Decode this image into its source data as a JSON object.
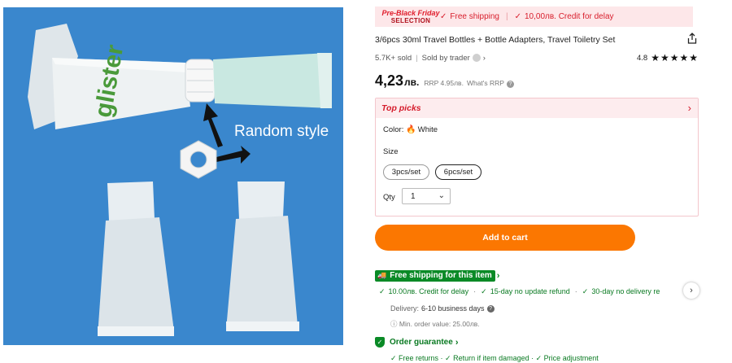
{
  "image": {
    "overlay_text": "Random style",
    "tube_brand_text": "glister"
  },
  "promo": {
    "logo_line1": "Pre-Black Friday",
    "logo_line2": "SELECTION",
    "free_shipping": "Free shipping",
    "credit": "10,00лв. Credit for delay",
    "accent_color": "#d81e2c"
  },
  "product": {
    "title": "3/6pcs 30ml Travel Bottles + Bottle Adapters, Travel Toiletry Set",
    "sold": "5.7K+ sold",
    "sold_by_label": "Sold by trader",
    "rating": "4.8",
    "stars": "★★★★★",
    "price_main": "4,23",
    "price_currency": "лв.",
    "rrp": "RRP 4.95лв.",
    "whats_rrp": "What's RRP"
  },
  "picks": {
    "title": "Top picks",
    "color_label": "Color:",
    "color_value": "White",
    "size_label": "Size",
    "size_options": [
      "3pcs/set",
      "6pcs/set"
    ],
    "selected_size": "6pcs/set",
    "qty_label": "Qty",
    "qty_value": "1"
  },
  "cart": {
    "label": "Add to cart",
    "color": "#fb7701"
  },
  "shipping": {
    "badge": "Free shipping for this item",
    "benefits": [
      "10.00лв. Credit for delay",
      "15-day no update refund",
      "30-day no delivery re"
    ],
    "delivery_label": "Delivery:",
    "delivery_value": "6-10 business days",
    "min_order": "Min. order value: 25.00лв.",
    "green": "#0a8a26"
  },
  "guarantee": {
    "label": "Order guarantee",
    "items": "✓ Free returns  ·  ✓ Return if item damaged  ·  ✓ Price adjustment"
  },
  "icons": [
    "share-icon",
    "check-icon",
    "fire-icon",
    "truck-icon",
    "shield-icon",
    "chevron-right-icon",
    "chevron-down-icon",
    "info-icon"
  ]
}
